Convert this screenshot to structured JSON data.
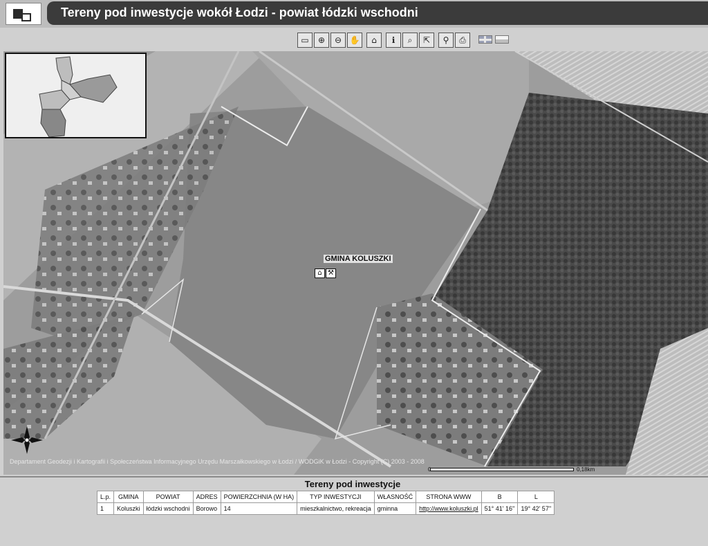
{
  "app": {
    "title": "Tereny pod inwestycje wokół Łodzi - powiat łódzki wschodni"
  },
  "toolbar": {
    "tools": [
      {
        "name": "full-extent-icon",
        "glyph": "▭"
      },
      {
        "name": "zoom-in-icon",
        "glyph": "⊕"
      },
      {
        "name": "zoom-out-icon",
        "glyph": "⊖"
      },
      {
        "name": "pan-hand-icon",
        "glyph": "✋"
      },
      {
        "name": "overview-icon",
        "glyph": "⌂"
      },
      {
        "name": "info-icon",
        "glyph": "ℹ"
      },
      {
        "name": "identify-icon",
        "glyph": "⌕"
      },
      {
        "name": "select-icon",
        "glyph": "⇱"
      },
      {
        "name": "search-icon",
        "glyph": "⚲"
      },
      {
        "name": "print-icon",
        "glyph": "⎙"
      }
    ],
    "languages": [
      {
        "name": "flag-en-icon"
      },
      {
        "name": "flag-pl-icon"
      }
    ]
  },
  "map": {
    "label": "GMINA KOLUSZKI",
    "copyright": "Departament Geodezji i Kartografii i Społeczeństwa Informacyjnego Urzędu Marszałkowskiego w Łodzi / WODGiK w Łodzi - Copyright (C) 2003 - 2008",
    "scale": {
      "start": "0",
      "end": "0,18km"
    }
  },
  "table": {
    "title": "Tereny pod inwestycje",
    "columns": [
      "L.p.",
      "GMINA",
      "POWIAT",
      "ADRES",
      "POWIERZCHNIA (W HA)",
      "TYP INWESTYCJI",
      "WŁASNOŚĆ",
      "STRONA WWW",
      "B",
      "L"
    ],
    "rows": [
      [
        "1",
        "Koluszki",
        "łódzki wschodni",
        "Borowo",
        "14",
        "mieszkalnictwo, rekreacja",
        "gminna",
        "http://www.koluszki.pl",
        "51° 41' 16''",
        "19° 42' 57''"
      ]
    ]
  },
  "colors": {
    "title_bar": "#3b3b3b",
    "header_bg": "#bdbdbd",
    "panel_bg": "#d0d0d0"
  }
}
